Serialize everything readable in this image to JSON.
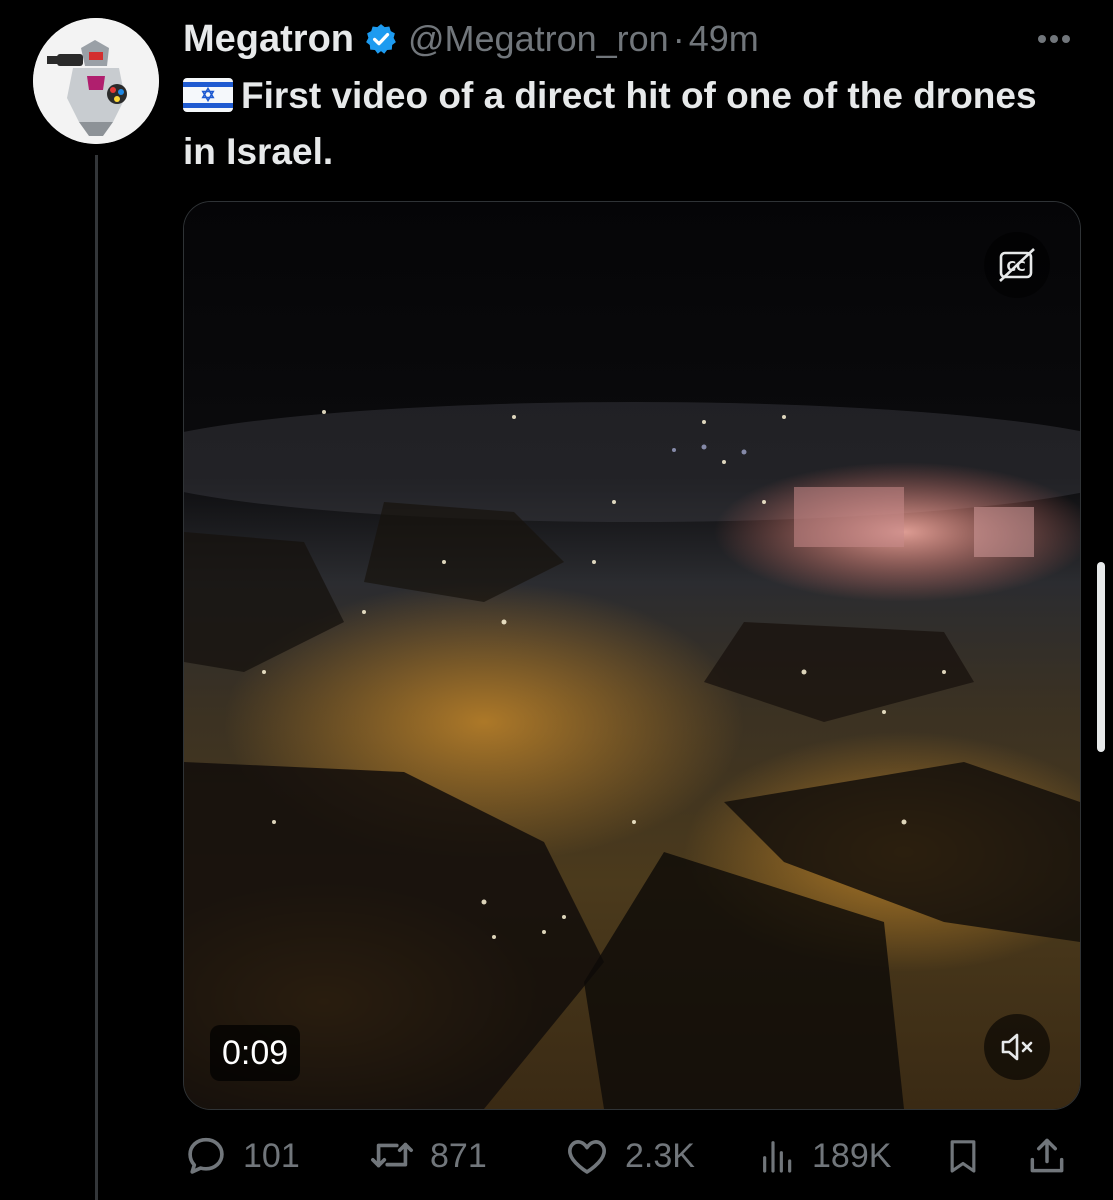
{
  "tweet": {
    "display_name": "Megatron",
    "handle": "@Megatron_ron",
    "separator": "·",
    "time": "49m",
    "text": "First video of a direct hit of one of the drones in Israel.",
    "flag_icon": "israel-flag-icon",
    "verified_color": "#1d9bf0"
  },
  "media": {
    "duration": "0:09",
    "cc_icon": "closed-captions-off-icon",
    "mute_icon": "speaker-muted-icon"
  },
  "actions": {
    "replies": "101",
    "reposts": "871",
    "likes": "2.3K",
    "views": "189K"
  },
  "colors": {
    "background": "#000000",
    "text_primary": "#e7e9ea",
    "text_secondary": "#71767b"
  }
}
